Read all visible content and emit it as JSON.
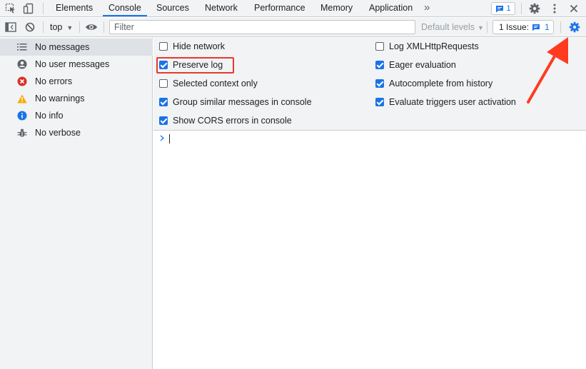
{
  "tabbar": {
    "tabs": [
      {
        "label": "Elements"
      },
      {
        "label": "Console"
      },
      {
        "label": "Sources"
      },
      {
        "label": "Network"
      },
      {
        "label": "Performance"
      },
      {
        "label": "Memory"
      },
      {
        "label": "Application"
      }
    ],
    "more_label": "»",
    "messages_count": "1"
  },
  "toolbar": {
    "context": "top",
    "filter_placeholder": "Filter",
    "levels": "Default levels",
    "issues_label": "1 Issue:",
    "issues_count": "1"
  },
  "sidebar": {
    "items": [
      {
        "label": "No messages"
      },
      {
        "label": "No user messages"
      },
      {
        "label": "No errors"
      },
      {
        "label": "No warnings"
      },
      {
        "label": "No info"
      },
      {
        "label": "No verbose"
      }
    ]
  },
  "settings": {
    "left": [
      {
        "label": "Hide network",
        "checked": false
      },
      {
        "label": "Preserve log",
        "checked": true
      },
      {
        "label": "Selected context only",
        "checked": false
      },
      {
        "label": "Group similar messages in console",
        "checked": true
      },
      {
        "label": "Show CORS errors in console",
        "checked": true
      }
    ],
    "right": [
      {
        "label": "Log XMLHttpRequests",
        "checked": false
      },
      {
        "label": "Eager evaluation",
        "checked": true
      },
      {
        "label": "Autocomplete from history",
        "checked": true
      },
      {
        "label": "Evaluate triggers user activation",
        "checked": true
      }
    ]
  },
  "colors": {
    "accent": "#1a73e8",
    "error": "#d93025",
    "warning": "#f9ab00",
    "annotation": "#ff3b1f"
  }
}
